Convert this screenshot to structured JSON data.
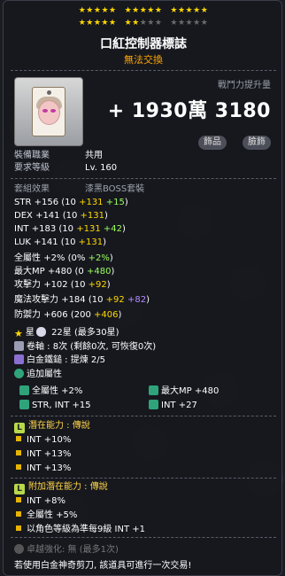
{
  "stars": {
    "row1a": "★★★★★",
    "row1b": "★★★★★",
    "row1c": "★★★★★",
    "row2a": "★★★★★",
    "row2b": "★★",
    "row2c": "★★★",
    "row2d": "★★★★★"
  },
  "item": {
    "name": "口紅控制器標誌",
    "trade": "無法交換"
  },
  "combat": {
    "label": "戰鬥力提升量",
    "value": "+ 1930萬 3180"
  },
  "badges": [
    "飾品",
    "臉飾"
  ],
  "req": {
    "job_label": "裝備職業",
    "job_value": "共用",
    "level_label": "要求等級",
    "level_value": "Lv. 160"
  },
  "set": {
    "label": "套組效果",
    "name": "漆黑BOSS套裝"
  },
  "stats": [
    {
      "name": "STR",
      "total": "+156",
      "base": "10",
      "scroll": "+131",
      "flame": "+15"
    },
    {
      "name": "DEX",
      "total": "+141",
      "base": "10",
      "scroll": "+131"
    },
    {
      "name": "INT",
      "total": "+183",
      "base": "10",
      "scroll": "+131",
      "flame": "+42"
    },
    {
      "name": "LUK",
      "total": "+141",
      "base": "10",
      "scroll": "+131"
    },
    {
      "name": "全屬性",
      "total": "+2%",
      "base": "0%",
      "flame": "+2%"
    },
    {
      "name": "最大MP",
      "total": "+480",
      "base": "0",
      "flame": "+480"
    },
    {
      "name": "攻擊力",
      "total": "+102",
      "base": "10",
      "scroll": "+92"
    },
    {
      "name": "魔法攻擊力",
      "total": "+184",
      "base": "10",
      "scroll": "+92",
      "extra": "+82"
    },
    {
      "name": "防禦力",
      "total": "+606",
      "base": "200",
      "scroll": "+406"
    }
  ],
  "upgrades": {
    "star_label": "星",
    "star_value": "22星 (最多30星)",
    "scroll": "卷軸 : 8次 (剩餘0次, 可恢復0次)",
    "hammer": "白金鐵鎚 : 提煉 2/5"
  },
  "bonus": {
    "header": "追加屬性",
    "items": [
      "全屬性 +2%",
      "STR, INT +15",
      "最大MP +480",
      "INT +27"
    ]
  },
  "potential": {
    "header": "潛在能力 : 傳說",
    "lines": [
      "INT +10%",
      "INT +13%",
      "INT +13%"
    ]
  },
  "additional": {
    "header": "附加潛在能力 : 傳說",
    "lines": [
      "INT +8%",
      "全屬性 +5%",
      "以角色等級為準每9級 INT +1"
    ]
  },
  "soul": {
    "text": "卓越強化:  無 (最多1次)"
  },
  "footer": {
    "text": "若使用白金神奇剪刀, 該道具可進行一次交易!"
  }
}
